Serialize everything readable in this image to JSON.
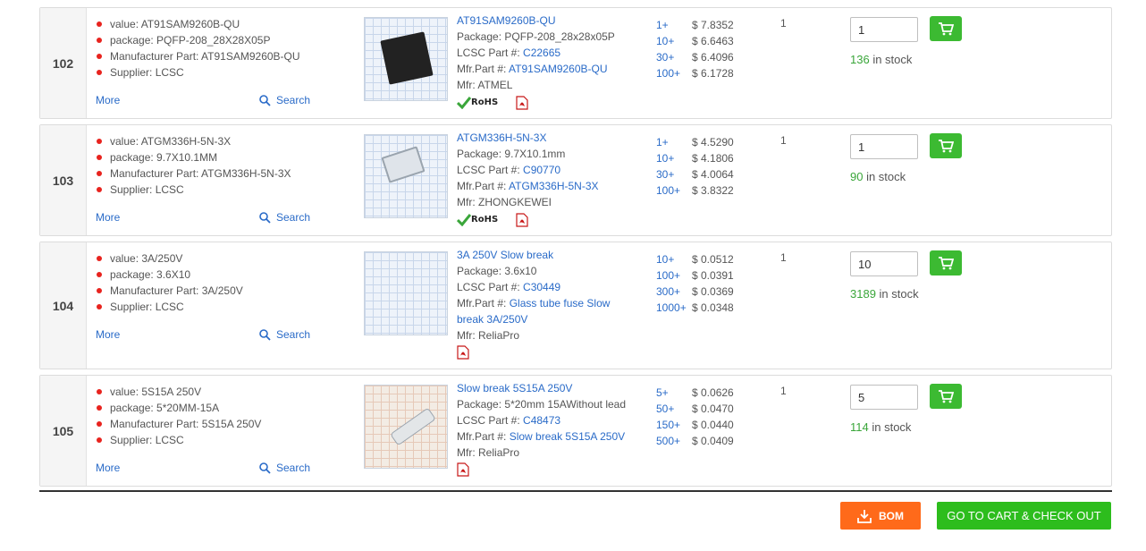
{
  "rows": [
    {
      "num": "102",
      "attrs": [
        "value: AT91SAM9260B-QU",
        "package: PQFP-208_28X28X05P",
        "Manufacturer Part: AT91SAM9260B-QU",
        "Supplier: LCSC"
      ],
      "more": "More",
      "search": "Search",
      "info": {
        "title": "AT91SAM9260B-QU",
        "package_label": "Package:",
        "package": "PQFP-208_28x28x05P",
        "lcsc_label": "LCSC Part #:",
        "lcsc": "C22665",
        "mfr_part_label": "Mfr.Part #:",
        "mfr_part": "AT91SAM9260B-QU",
        "mfr_label": "Mfr:",
        "mfr": "ATMEL",
        "rohs": "RoHS"
      },
      "tiers": [
        [
          "1+",
          "$ 7.8352"
        ],
        [
          "10+",
          "$ 6.6463"
        ],
        [
          "30+",
          "$ 6.4096"
        ],
        [
          "100+",
          "$ 6.1728"
        ]
      ],
      "moq": "1",
      "qty": "1",
      "stock_count": "136",
      "stock_suffix": " in stock"
    },
    {
      "num": "103",
      "attrs": [
        "value: ATGM336H-5N-3X",
        "package: 9.7X10.1MM",
        "Manufacturer Part: ATGM336H-5N-3X",
        "Supplier: LCSC"
      ],
      "more": "More",
      "search": "Search",
      "info": {
        "title": "ATGM336H-5N-3X",
        "package_label": "Package:",
        "package": "9.7X10.1mm",
        "lcsc_label": "LCSC Part #:",
        "lcsc": "C90770",
        "mfr_part_label": "Mfr.Part #:",
        "mfr_part": "ATGM336H-5N-3X",
        "mfr_label": "Mfr:",
        "mfr": "ZHONGKEWEI",
        "rohs": "RoHS"
      },
      "tiers": [
        [
          "1+",
          "$ 4.5290"
        ],
        [
          "10+",
          "$ 4.1806"
        ],
        [
          "30+",
          "$ 4.0064"
        ],
        [
          "100+",
          "$ 3.8322"
        ]
      ],
      "moq": "1",
      "qty": "1",
      "stock_count": "90",
      "stock_suffix": " in stock"
    },
    {
      "num": "104",
      "attrs": [
        "value: 3A/250V",
        "package: 3.6X10",
        "Manufacturer Part: 3A/250V",
        "Supplier: LCSC"
      ],
      "more": "More",
      "search": "Search",
      "info": {
        "title": "3A 250V Slow break",
        "package_label": "Package:",
        "package": "3.6x10",
        "lcsc_label": "LCSC Part #:",
        "lcsc": "C30449",
        "mfr_part_label": "Mfr.Part #:",
        "mfr_part": "Glass tube fuse Slow break 3A/250V",
        "mfr_label": "Mfr:",
        "mfr": "ReliaPro"
      },
      "tiers": [
        [
          "10+",
          "$ 0.0512"
        ],
        [
          "100+",
          "$ 0.0391"
        ],
        [
          "300+",
          "$ 0.0369"
        ],
        [
          "1000+",
          "$ 0.0348"
        ]
      ],
      "moq": "1",
      "qty": "10",
      "stock_count": "3189",
      "stock_suffix": " in stock"
    },
    {
      "num": "105",
      "attrs": [
        "value: 5S15A 250V",
        "package: 5*20MM-15A",
        "Manufacturer Part: 5S15A 250V",
        "Supplier: LCSC"
      ],
      "more": "More",
      "search": "Search",
      "info": {
        "title": "Slow break 5S15A 250V",
        "package_label": "Package:",
        "package": "5*20mm 15AWithout lead",
        "lcsc_label": "LCSC Part #:",
        "lcsc": "C48473",
        "mfr_part_label": "Mfr.Part #:",
        "mfr_part": "Slow break 5S15A 250V",
        "mfr_label": "Mfr:",
        "mfr": "ReliaPro"
      },
      "tiers": [
        [
          "5+",
          "$ 0.0626"
        ],
        [
          "50+",
          "$ 0.0470"
        ],
        [
          "150+",
          "$ 0.0440"
        ],
        [
          "500+",
          "$ 0.0409"
        ]
      ],
      "moq": "1",
      "qty": "5",
      "stock_count": "114",
      "stock_suffix": " in stock"
    }
  ],
  "footer": {
    "bom_label": "BOM",
    "checkout_label": "GO TO CART & CHECK OUT"
  },
  "colors": {
    "link": "#2a6bc8",
    "bullet": "#e8231e",
    "cart_green": "#3cba32",
    "stock_green": "#3aa63a",
    "bom_orange": "#ff6a1a",
    "checkout_green": "#2dbd1d"
  },
  "icons": {
    "search": "search-icon",
    "cart": "cart-icon",
    "pdf": "pdf-icon",
    "rohs": "rohs-icon",
    "download": "download-icon"
  }
}
